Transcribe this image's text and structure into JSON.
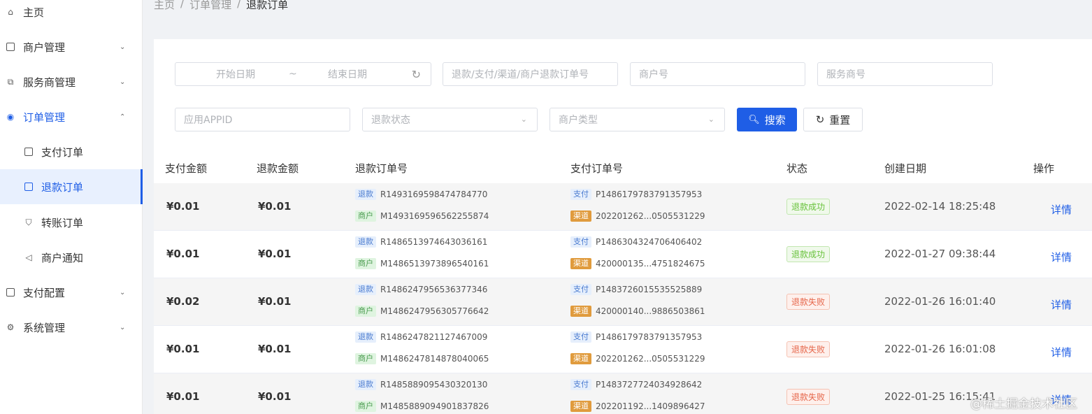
{
  "sidebar": {
    "items": [
      {
        "label": "主页",
        "icon": "home-icon"
      },
      {
        "label": "商户管理",
        "icon": "merchant-icon"
      },
      {
        "label": "服务商管理",
        "icon": "provider-icon"
      },
      {
        "label": "订单管理",
        "icon": "order-icon"
      },
      {
        "label": "支付订单",
        "icon": "pay-order-icon"
      },
      {
        "label": "退款订单",
        "icon": "refund-order-icon"
      },
      {
        "label": "转账订单",
        "icon": "transfer-order-icon"
      },
      {
        "label": "商户通知",
        "icon": "notify-icon"
      },
      {
        "label": "支付配置",
        "icon": "pay-config-icon"
      },
      {
        "label": "系统管理",
        "icon": "system-icon"
      }
    ]
  },
  "breadcrumb": [
    "主页",
    "订单管理",
    "退款订单"
  ],
  "breadcrumb_sep": "/",
  "filters": {
    "start_date": "开始日期",
    "date_sep": "~",
    "end_date": "结束日期",
    "order_no": "退款/支付/渠道/商户退款订单号",
    "merchant_no": "商户号",
    "provider_no": "服务商号",
    "app_id": "应用APPID",
    "refund_status": "退款状态",
    "merchant_type": "商户类型",
    "search": "搜索",
    "reset": "重置"
  },
  "table": {
    "headers": [
      "支付金额",
      "退款金额",
      "退款订单号",
      "支付订单号",
      "状态",
      "创建日期",
      "操作"
    ],
    "tags": {
      "refund": "退款",
      "merchant": "商户",
      "pay": "支付",
      "channel": "渠道"
    },
    "detail": "详情",
    "rows": [
      {
        "pay_amount": "¥0.01",
        "refund_amount": "¥0.01",
        "refund_no": "R1493169598474784770",
        "merchant_refund_no": "M1493169596562255874",
        "pay_no": "P1486179783791357953",
        "channel_no": "202201262...0505531229",
        "status": "退款成功",
        "status_type": "ok",
        "created": "2022-02-14 18:25:48"
      },
      {
        "pay_amount": "¥0.01",
        "refund_amount": "¥0.01",
        "refund_no": "R1486513974643036161",
        "merchant_refund_no": "M1486513973896540161",
        "pay_no": "P1486304324706406402",
        "channel_no": "420000135...4751824675",
        "status": "退款成功",
        "status_type": "ok",
        "created": "2022-01-27 09:38:44"
      },
      {
        "pay_amount": "¥0.02",
        "refund_amount": "¥0.01",
        "refund_no": "R1486247956536377346",
        "merchant_refund_no": "M1486247956305776642",
        "pay_no": "P1483726015535525889",
        "channel_no": "420000140...9886503861",
        "status": "退款失败",
        "status_type": "fail",
        "created": "2022-01-26 16:01:40"
      },
      {
        "pay_amount": "¥0.01",
        "refund_amount": "¥0.01",
        "refund_no": "R1486247821127467009",
        "merchant_refund_no": "M1486247814878040065",
        "pay_no": "P1486179783791357953",
        "channel_no": "202201262...0505531229",
        "status": "退款失败",
        "status_type": "fail",
        "created": "2022-01-26 16:01:08"
      },
      {
        "pay_amount": "¥0.01",
        "refund_amount": "¥0.01",
        "refund_no": "R1485889095430320130",
        "merchant_refund_no": "M1485889094901837826",
        "pay_no": "P1483727724034928642",
        "channel_no": "202201192...1409896427",
        "status": "退款失败",
        "status_type": "fail",
        "created": "2022-01-25 16:15:41"
      }
    ]
  },
  "watermark": "@稀土掘金技术社区",
  "colors": {
    "accent": "#1f5ee6",
    "success": "#67c23a",
    "fail": "#e6664a",
    "channel_tag": "#e09b3d"
  }
}
